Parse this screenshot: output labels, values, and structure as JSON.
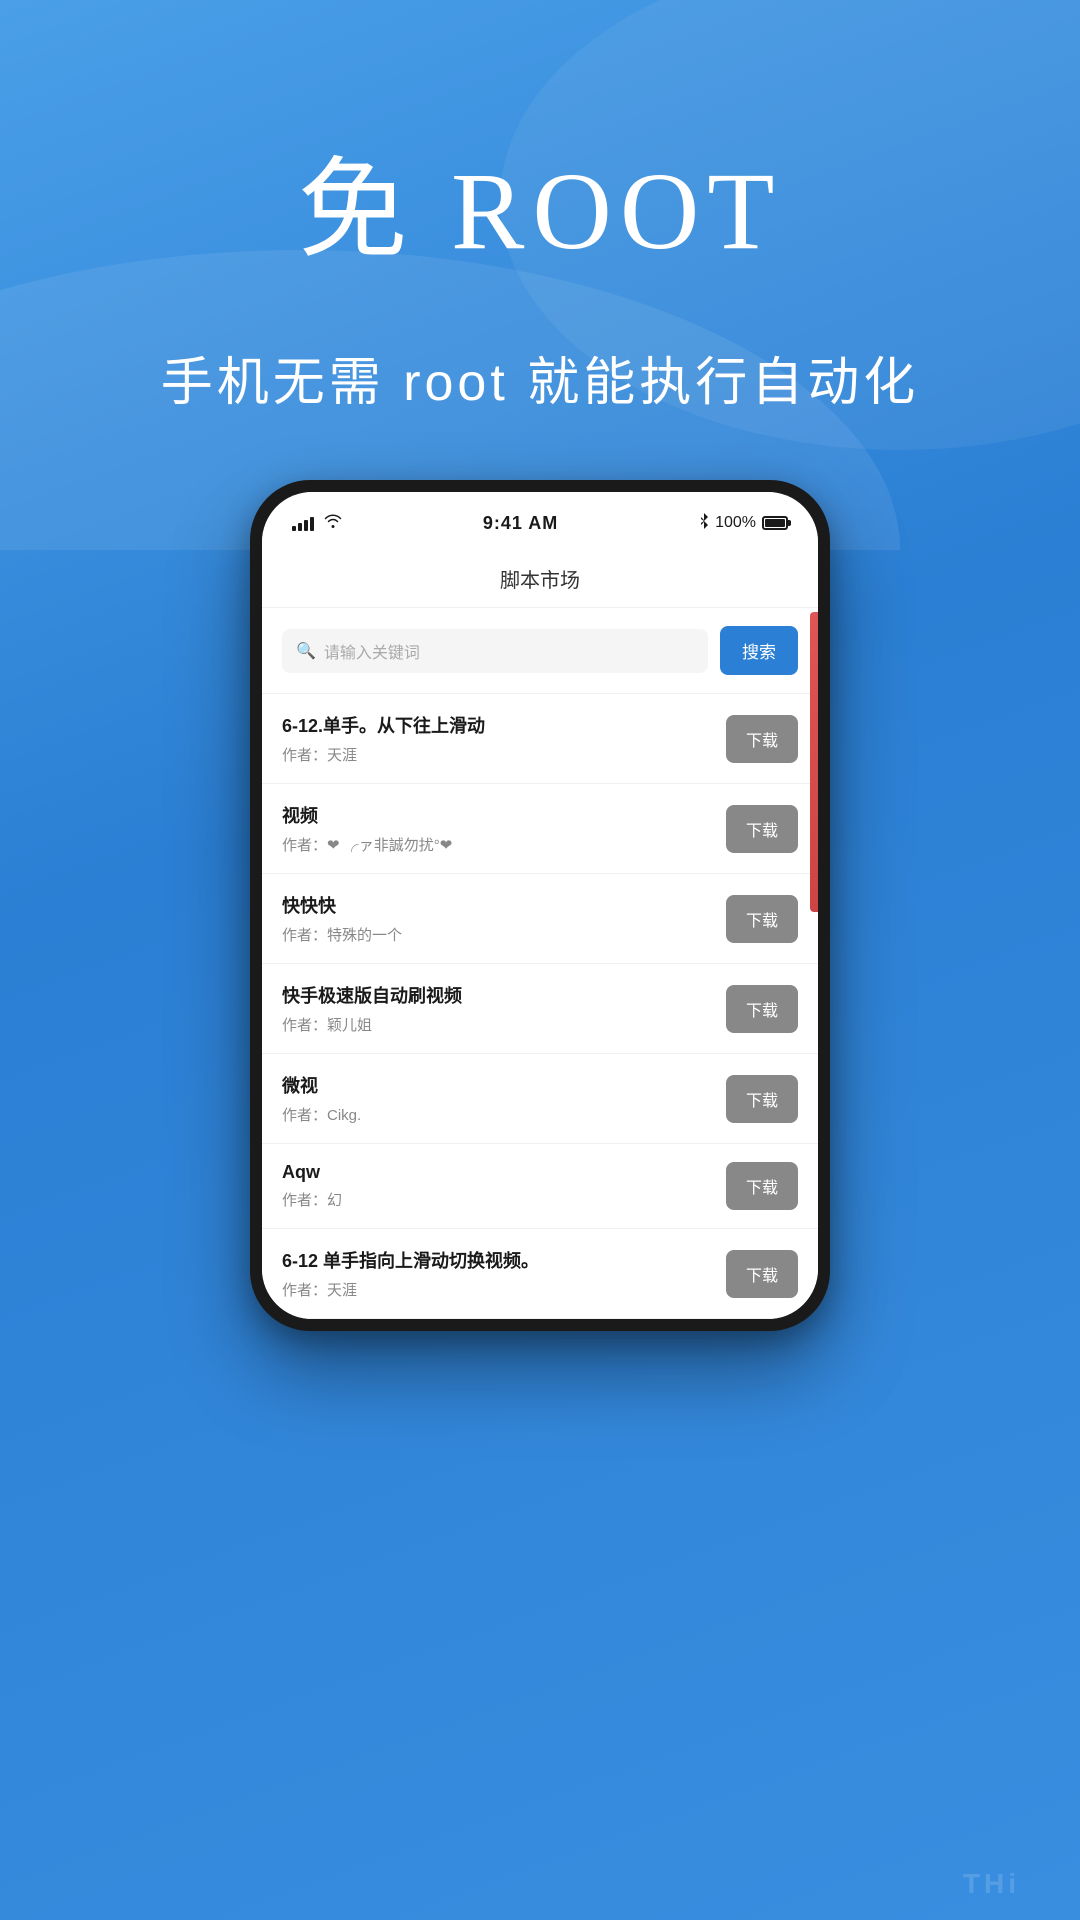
{
  "hero": {
    "title": "免 ROOT",
    "subtitle": "手机无需 root 就能执行自动化"
  },
  "phone": {
    "status_bar": {
      "time": "9:41 AM",
      "battery_percent": "100%",
      "bluetooth": "✦"
    },
    "app_title": "脚本市场",
    "search": {
      "placeholder": "请输入关键词",
      "button_label": "搜索"
    },
    "list_items": [
      {
        "name": "6-12.单手。从下往上滑动",
        "author": "作者：天涯",
        "download_label": "下载"
      },
      {
        "name": "视频",
        "author": "作者：❤ ╭ァ非誠勿扰°❤",
        "download_label": "下载"
      },
      {
        "name": "快快快",
        "author": "作者：特殊的一个",
        "download_label": "下载"
      },
      {
        "name": "快手极速版自动刷视频",
        "author": "作者：颖儿姐",
        "download_label": "下载"
      },
      {
        "name": "微视",
        "author": "作者：Cikg.",
        "download_label": "下载"
      },
      {
        "name": "Aqw",
        "author": "作者：幻",
        "download_label": "下载"
      },
      {
        "name": "6-12 单手指向上滑动切换视频。",
        "author": "作者：天涯",
        "download_label": "下载"
      }
    ]
  },
  "bottom_text": "THi"
}
